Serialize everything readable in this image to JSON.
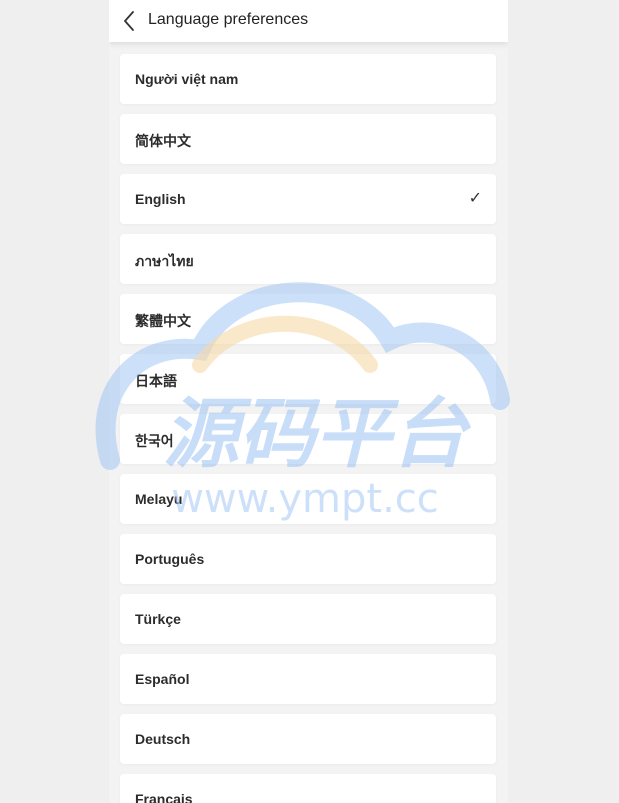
{
  "header": {
    "title": "Language preferences",
    "back_icon": "chevron-left-icon"
  },
  "languages": [
    {
      "label": "Người việt nam",
      "selected": false
    },
    {
      "label": "简体中文",
      "selected": false
    },
    {
      "label": "English",
      "selected": true
    },
    {
      "label": "ภาษาไทย",
      "selected": false
    },
    {
      "label": "繁體中文",
      "selected": false
    },
    {
      "label": "日本語",
      "selected": false
    },
    {
      "label": "한국어",
      "selected": false
    },
    {
      "label": "Melayu",
      "selected": false
    },
    {
      "label": "Português",
      "selected": false
    },
    {
      "label": "Türkçe",
      "selected": false
    },
    {
      "label": "Español",
      "selected": false
    },
    {
      "label": "Deutsch",
      "selected": false
    },
    {
      "label": "Français",
      "selected": false
    }
  ],
  "check_symbol": "✓",
  "watermark": {
    "main_text": "源码平台",
    "url_text": "www.ympt.cc"
  },
  "colors": {
    "page_bg": "#efefef",
    "card_bg": "#ffffff",
    "watermark_blue": "#9cc2f4",
    "watermark_orange": "#f7d9a6"
  }
}
